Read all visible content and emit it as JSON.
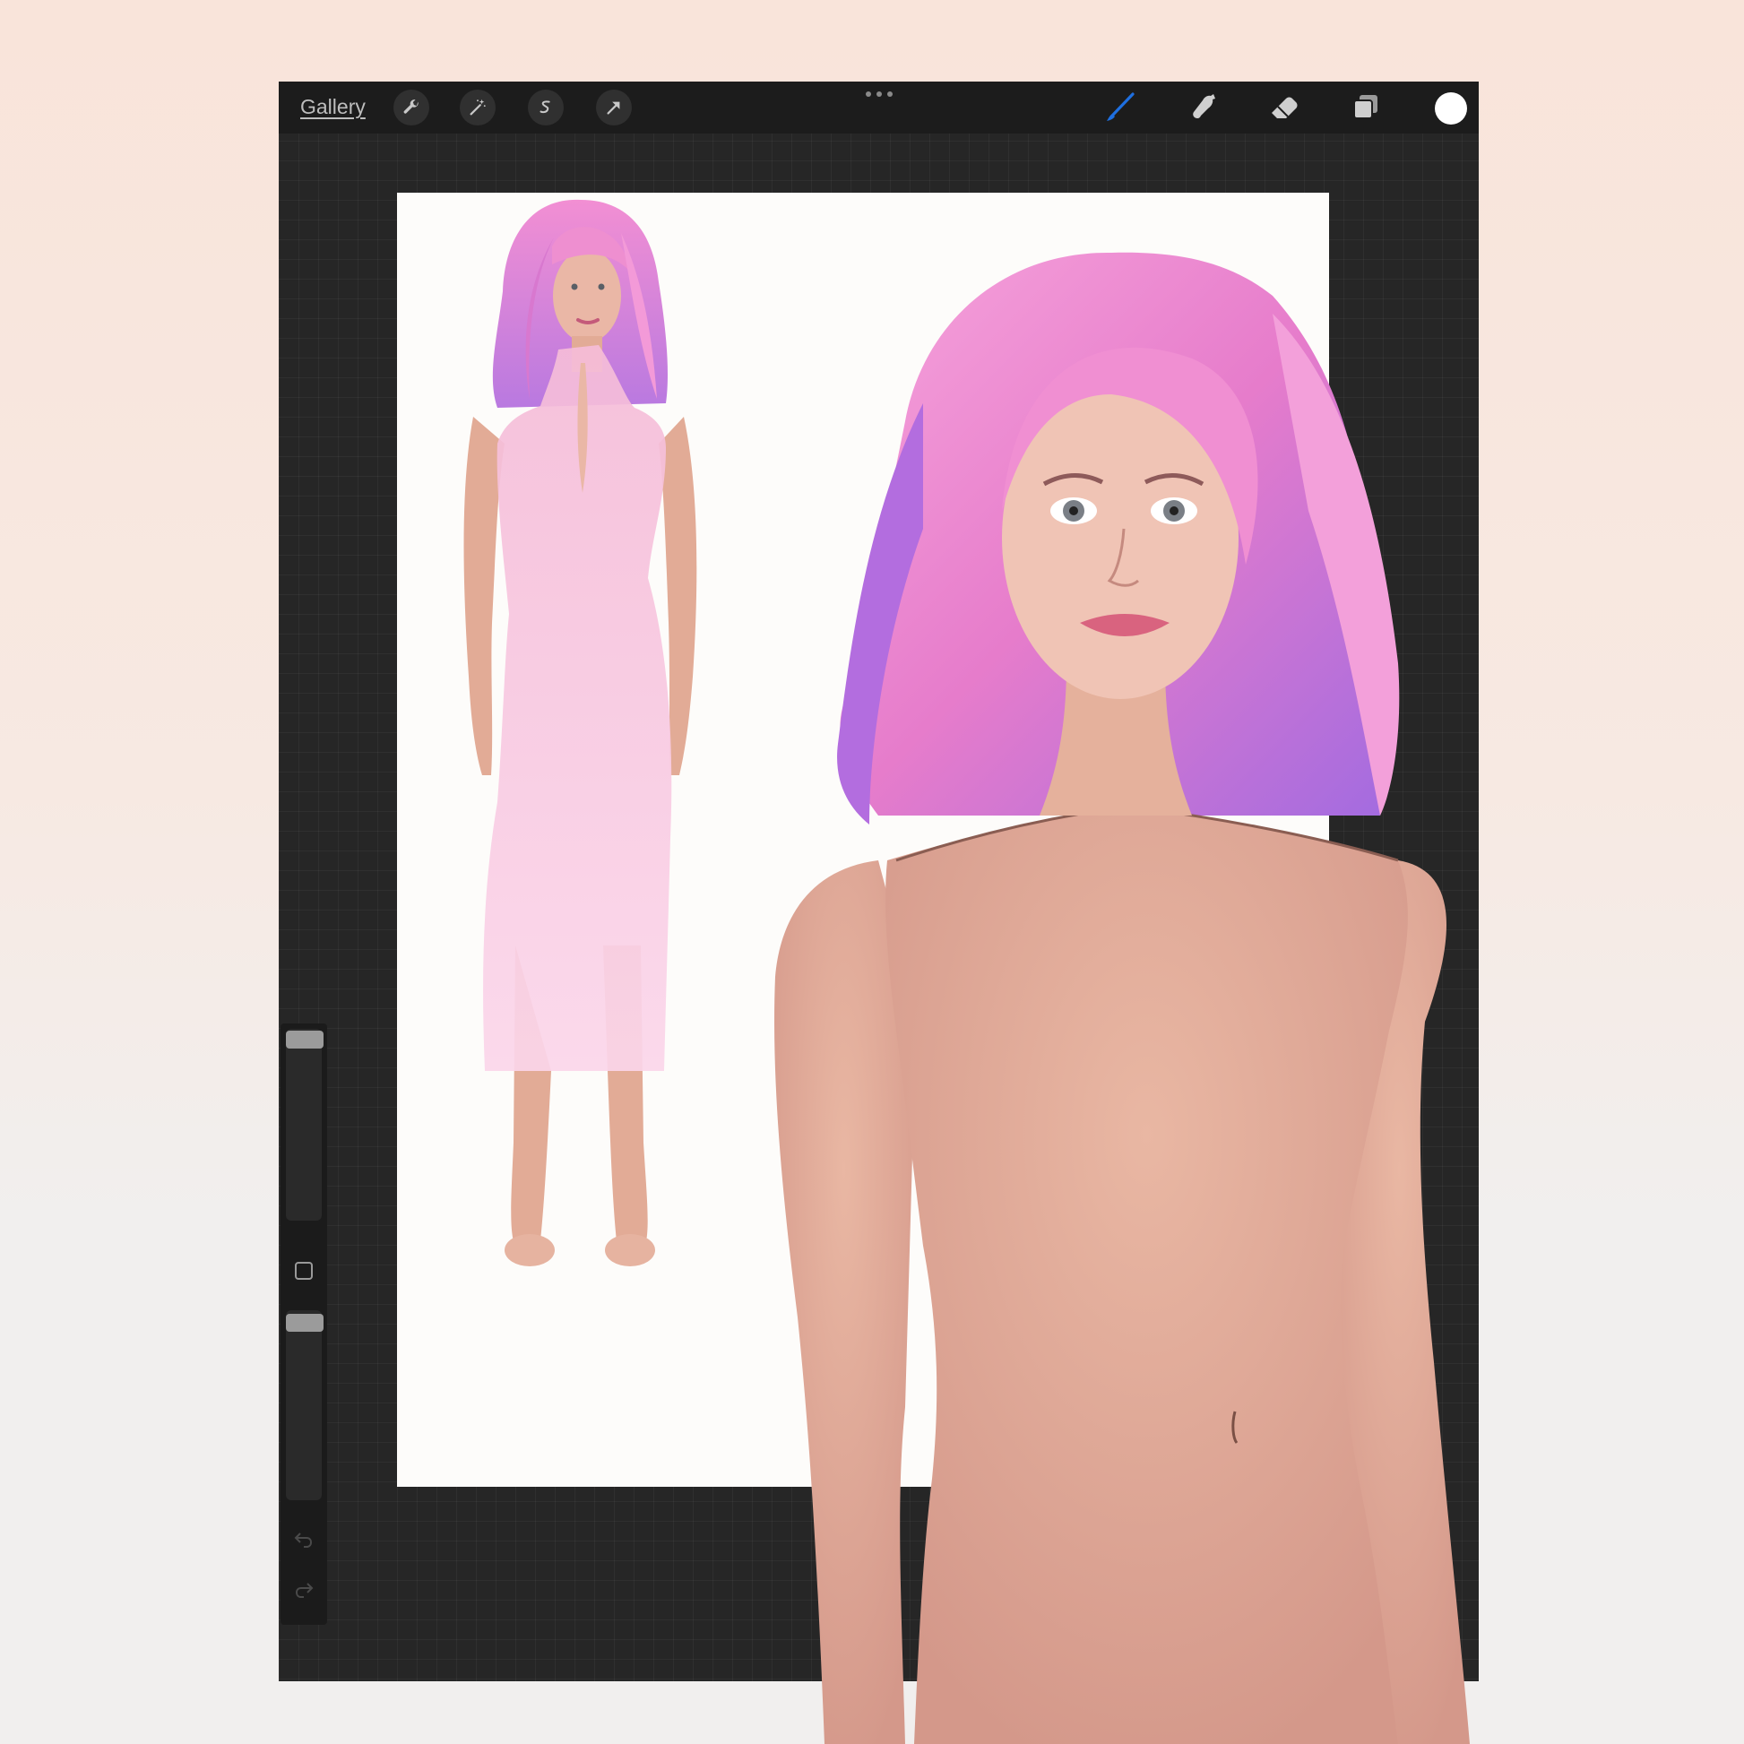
{
  "toolbar": {
    "gallery_label": "Gallery",
    "left_tools": [
      "wrench-icon",
      "magic-wand-icon",
      "selection-icon",
      "transform-arrow-icon"
    ],
    "right_tools": [
      "brush-icon",
      "smudge-icon",
      "eraser-icon",
      "layers-icon"
    ],
    "active_tool": "brush-icon",
    "active_color": "#ffffff",
    "accent_color": "#1e6fe0"
  },
  "sidebar": {
    "brush_size_icon": "slider",
    "opacity_icon": "slider",
    "modify_icon": "square-icon",
    "undo_icon": "undo-arrow-icon",
    "redo_icon": "redo-arrow-icon"
  },
  "colors": {
    "background": "#f1efee",
    "canvas_bg": "#262626",
    "page": "#fdfcfa",
    "hair": "#e889cb",
    "dress": "#f6c6df",
    "skin": "#e0ad98"
  }
}
